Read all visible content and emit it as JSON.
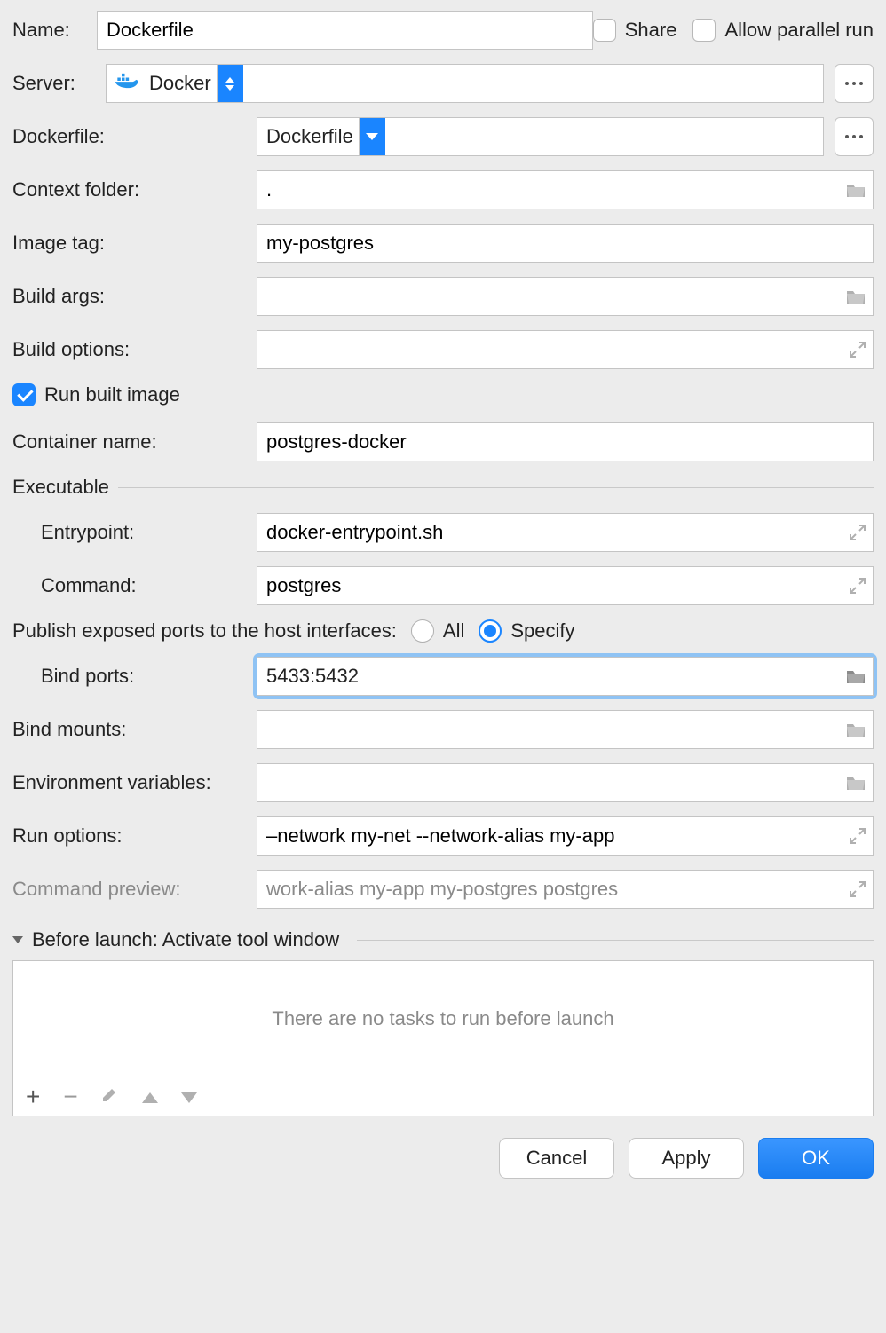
{
  "labels": {
    "name": "Name:",
    "server": "Server:",
    "dockerfile": "Dockerfile:",
    "context_folder": "Context folder:",
    "image_tag": "Image tag:",
    "build_args": "Build args:",
    "build_options": "Build options:",
    "run_built_image": "Run built image",
    "container_name": "Container name:",
    "executable": "Executable",
    "entrypoint": "Entrypoint:",
    "command": "Command:",
    "publish_ports": "Publish exposed ports to the host interfaces:",
    "bind_ports": "Bind ports:",
    "bind_mounts": "Bind mounts:",
    "env_vars": "Environment variables:",
    "run_options": "Run options:",
    "command_preview": "Command preview:",
    "before_launch": "Before launch: Activate tool window",
    "no_tasks": "There are no tasks to run before launch"
  },
  "checkboxes": {
    "share": {
      "label": "Share",
      "checked": false
    },
    "allow_parallel": {
      "label": "Allow parallel run",
      "checked": false
    },
    "run_built_image": {
      "checked": true
    }
  },
  "radios": {
    "all": {
      "label": "All",
      "checked": false
    },
    "specify": {
      "label": "Specify",
      "checked": true
    }
  },
  "fields": {
    "name": "Dockerfile",
    "server": "Docker",
    "dockerfile": "Dockerfile",
    "context_folder": ".",
    "image_tag": "my-postgres",
    "build_args": "",
    "build_options": "",
    "container_name": "postgres-docker",
    "entrypoint": "docker-entrypoint.sh",
    "command": "postgres",
    "bind_ports": "5433:5432",
    "bind_mounts": "",
    "env_vars": "",
    "run_options": "–network my-net --network-alias my-app",
    "command_preview": "work-alias my-app my-postgres postgres"
  },
  "buttons": {
    "cancel": "Cancel",
    "apply": "Apply",
    "ok": "OK"
  }
}
